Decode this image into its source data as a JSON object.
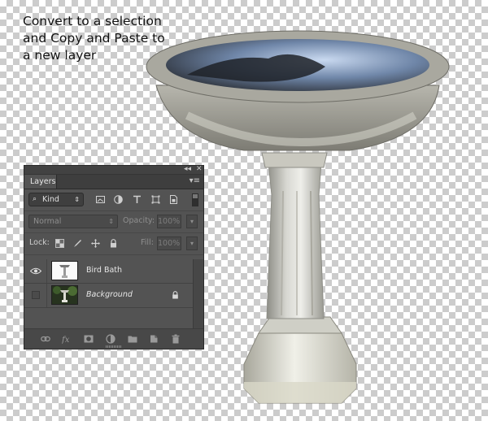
{
  "caption": {
    "line1": "Convert to a selection",
    "line2": "and Copy and Paste to",
    "line3": "a new layer"
  },
  "panel": {
    "tab_label": "Layers",
    "collapse_glyph": "◂◂",
    "close_glyph": "✕",
    "menu_glyph": "▾≡",
    "filter": {
      "kind_label": "Kind",
      "icons": [
        "pixel-layer-filter-icon",
        "adjustment-layer-filter-icon",
        "type-layer-filter-icon",
        "shape-layer-filter-icon",
        "smart-object-filter-icon"
      ]
    },
    "blend": {
      "mode": "Normal",
      "opacity_label": "Opacity:",
      "opacity_value": "100%"
    },
    "lock": {
      "label": "Lock:",
      "fill_label": "Fill:",
      "fill_value": "100%"
    },
    "layers": [
      {
        "name": "Bird Bath",
        "visible": true,
        "italic": false,
        "locked": false
      },
      {
        "name": "Background",
        "visible": false,
        "italic": true,
        "locked": true
      }
    ],
    "bottom_icons": [
      "link-layers-icon",
      "fx-icon",
      "layer-mask-icon",
      "adjustment-layer-icon",
      "new-group-icon",
      "new-layer-icon",
      "trash-icon"
    ]
  },
  "colors": {
    "panel_bg": "#535353",
    "panel_dark": "#3e3e3e",
    "checker": "#cccccc"
  }
}
